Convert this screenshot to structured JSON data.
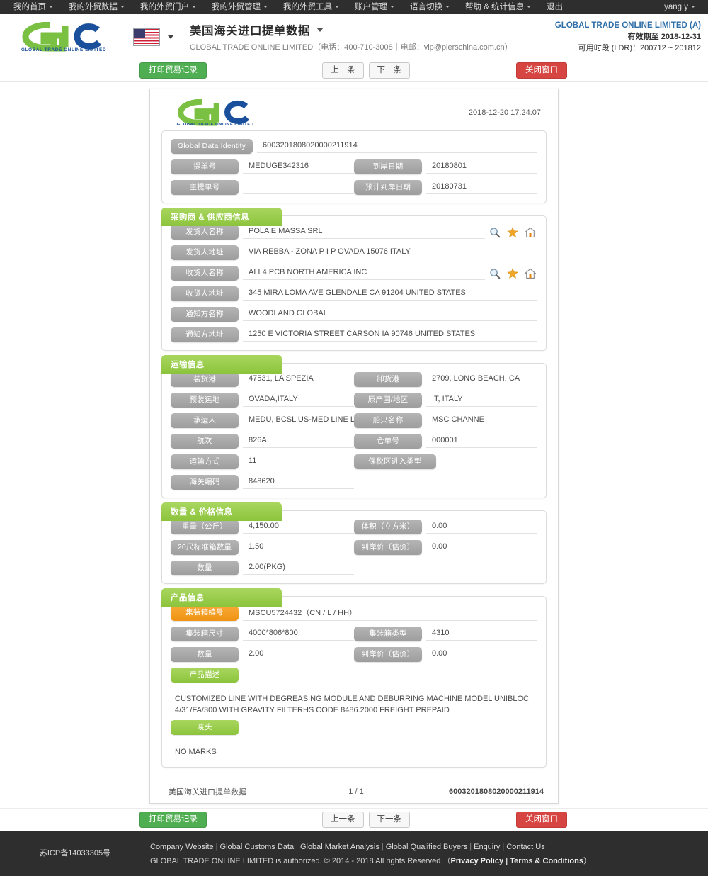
{
  "topnav": {
    "items": [
      {
        "label": "我的首页",
        "caret": true
      },
      {
        "label": "我的外贸数据",
        "caret": true
      },
      {
        "label": "我的外贸门户",
        "caret": true
      },
      {
        "label": "我的外贸管理",
        "caret": true
      },
      {
        "label": "我的外贸工具",
        "caret": true
      },
      {
        "label": "账户管理",
        "caret": true
      },
      {
        "label": "语言切换",
        "caret": true
      },
      {
        "label": "帮助 & 统计信息",
        "caret": true
      },
      {
        "label": "退出",
        "caret": false
      }
    ],
    "user": "yang.y"
  },
  "masthead": {
    "logo_text_top": "GTC",
    "logo_tagline": "GLOBAL TRADE ONLINE LIMITED",
    "flag": "us-flag-icon",
    "page_title": "美国海关进口提单数据",
    "company_line": "GLOBAL TRADE ONLINE LIMITED（电话：400-710-3008｜电邮：vip@pierschina.com.cn）",
    "account_name": "GLOBAL TRADE ONLINE LIMITED (A)",
    "account_expiry": "有效期至 2018-12-31",
    "account_ldr": "可用时段 (LDR)：200712 ~ 201812"
  },
  "actions": {
    "print": "打印贸易记录",
    "prev": "上一条",
    "next": "下一条",
    "close": "关闭窗口"
  },
  "document": {
    "timestamp": "2018-12-20 17:24:07",
    "identity": {
      "id_label": "Global Data Identity",
      "id_value": "6003201808020000211914",
      "rows": [
        {
          "label": "提单号",
          "value": "MEDUGE342316",
          "label2": "到岸日期",
          "value2": "20180801"
        },
        {
          "label": "主提单号",
          "value": "",
          "label2": "预计到岸日期",
          "value2": "20180731"
        }
      ]
    },
    "buyer_supplier": {
      "title": "采购商 & 供应商信息",
      "rows": [
        {
          "label": "发货人名称",
          "value": "POLA E MASSA SRL",
          "icons": true
        },
        {
          "label": "发货人地址",
          "value": "VIA REBBA - ZONA P I P OVADA 15076 ITALY",
          "icons": false
        },
        {
          "label": "收货人名称",
          "value": "ALL4 PCB NORTH AMERICA INC",
          "icons": true
        },
        {
          "label": "收货人地址",
          "value": "345 MIRA LOMA AVE GLENDALE CA 91204 UNITED STATES",
          "icons": false
        },
        {
          "label": "通知方名称",
          "value": "WOODLAND GLOBAL",
          "icons": false
        },
        {
          "label": "通知方地址",
          "value": "1250 E VICTORIA STREET CARSON IA 90746 UNITED STATES",
          "icons": false
        }
      ]
    },
    "transport": {
      "title": "运输信息",
      "rows": [
        {
          "label": "装货港",
          "value": "47531, LA SPEZIA",
          "label2": "卸货港",
          "value2": "2709, LONG BEACH, CA"
        },
        {
          "label": "预装运地",
          "value": "OVADA,ITALY",
          "label2": "原产国/地区",
          "value2": "IT, ITALY"
        },
        {
          "label": "承运人",
          "value": "MEDU, BCSL US-MED LINE LTD.",
          "label2": "船只名称",
          "value2": "MSC CHANNE"
        },
        {
          "label": "航次",
          "value": "826A",
          "label2": "仓单号",
          "value2": "000001"
        },
        {
          "label": "运输方式",
          "value": "11",
          "label2": "保税区进入类型",
          "value2": ""
        },
        {
          "label": "海关编码",
          "value": "848620",
          "label2": "",
          "value2": ""
        }
      ]
    },
    "quantity_price": {
      "title": "数量 & 价格信息",
      "rows": [
        {
          "label": "重量（公斤）",
          "value": "4,150.00",
          "label2": "体积（立方米）",
          "value2": "0.00"
        },
        {
          "label": "20尺标准箱数量",
          "value": "1.50",
          "label2": "到岸价（估价）",
          "value2": "0.00"
        },
        {
          "label": "数量",
          "value": "2.00(PKG)",
          "label2": "",
          "value2": ""
        }
      ]
    },
    "product": {
      "title": "产品信息",
      "container_label": "集装箱编号",
      "container_value": "MSCU5724432（CN / L / HH）",
      "rows": [
        {
          "label": "集装箱尺寸",
          "value": "4000*806*800",
          "label2": "集装箱类型",
          "value2": "4310"
        },
        {
          "label": "数量",
          "value": "2.00",
          "label2": "到岸价（估价）",
          "value2": "0.00"
        }
      ],
      "desc_label": "产品描述",
      "desc_value": "CUSTOMIZED LINE WITH DEGREASING MODULE AND DEBURRING MACHINE MODEL UNIBLOC 4/31/FA/300 WITH GRAVITY FILTERHS CODE 8486.2000 FREIGHT PREPAID",
      "marks_label": "唛头",
      "marks_value": "NO MARKS"
    },
    "footer": {
      "left": "美国海关进口提单数据",
      "mid": "1 / 1",
      "right": "6003201808020000211914"
    }
  },
  "site_footer": {
    "icp": "苏ICP备14033305号",
    "links": [
      "Company Website",
      "Global Customs Data",
      "Global Market Analysis",
      "Global Qualified Buyers",
      "Enquiry",
      "Contact Us"
    ],
    "copyright_pre": "GLOBAL TRADE ONLINE LIMITED is authorized. © 2014 - 2018 All rights Reserved.（",
    "privacy": "Privacy Policy",
    "copy_sep": " | ",
    "terms": "Terms & Conditions",
    "copyright_post": "）"
  },
  "colors": {
    "green": "#8cc43c",
    "orange": "#ef9413",
    "grey_label": "#a8a8a8",
    "dark_bar": "#2e2e2e",
    "accent_blue": "#2f6fa8",
    "red": "#d64541"
  }
}
